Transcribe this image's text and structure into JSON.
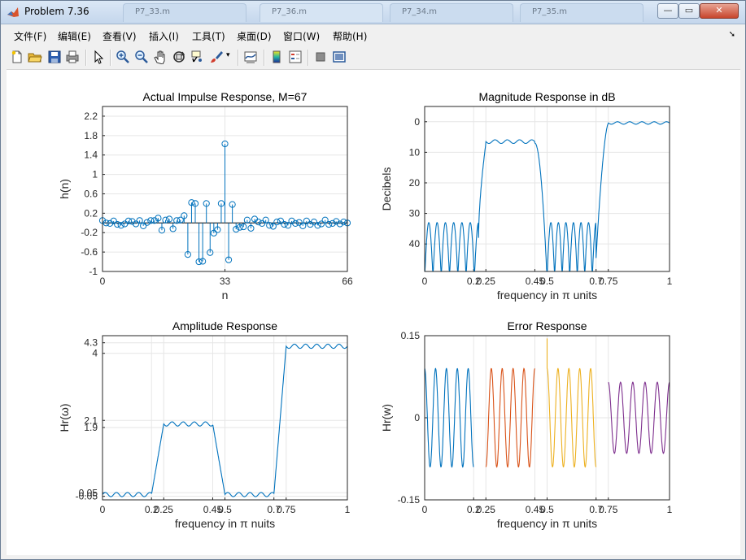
{
  "window": {
    "title": "Problem 7.36",
    "controls": {
      "minimize": "—",
      "restore": "▭",
      "close": "✕"
    }
  },
  "menu": {
    "items": [
      "文件(F)",
      "编辑(E)",
      "查看(V)",
      "插入(I)",
      "工具(T)",
      "桌面(D)",
      "窗口(W)",
      "帮助(H)"
    ]
  },
  "toolbar": {
    "icons": [
      "new-figure-icon",
      "open-file-icon",
      "save-icon",
      "print-icon",
      "pointer-icon",
      "zoom-in-icon",
      "zoom-out-icon",
      "pan-hand-icon",
      "rotate-3d-icon",
      "data-cursor-icon",
      "brush-icon",
      "brush-dropdown-icon",
      "link-plot-icon",
      "colorbar-icon",
      "legend-icon",
      "hide-plot-tools-icon",
      "show-plot-tools-icon"
    ]
  },
  "colors": {
    "series1": "#0072BD",
    "series2": "#D95319",
    "series3": "#EDB120",
    "series4": "#7E2F8E",
    "grid": "#e6e6e6",
    "axis": "#262626"
  },
  "chart_data": [
    {
      "type": "stem",
      "title": "Actual Impulse Response, M=67",
      "xlabel": "n",
      "ylabel": "h(n)",
      "xlim": [
        0,
        66
      ],
      "ylim": [
        -1,
        2.4
      ],
      "xticks": [
        0,
        33,
        66
      ],
      "xtick_labels": [
        "0",
        "33",
        "66"
      ],
      "yticks": [
        -1,
        -0.6,
        -0.2,
        0.2,
        0.6,
        1,
        1.4,
        1.8,
        2.2
      ],
      "ytick_labels": [
        "-1",
        "-0.6",
        "-0.2",
        "0.2",
        "0.6",
        "1",
        "1.4",
        "1.8",
        "2.2"
      ],
      "grid": true,
      "n": [
        0,
        1,
        2,
        3,
        4,
        5,
        6,
        7,
        8,
        9,
        10,
        11,
        12,
        13,
        14,
        15,
        16,
        17,
        18,
        19,
        20,
        21,
        22,
        23,
        24,
        25,
        26,
        27,
        28,
        29,
        30,
        31,
        32,
        33,
        34,
        35,
        36,
        37,
        38,
        39,
        40,
        41,
        42,
        43,
        44,
        45,
        46,
        47,
        48,
        49,
        50,
        51,
        52,
        53,
        54,
        55,
        56,
        57,
        58,
        59,
        60,
        61,
        62,
        63,
        64,
        65,
        66
      ],
      "values": [
        0.05,
        0.0,
        -0.01,
        0.04,
        -0.03,
        -0.05,
        -0.02,
        0.04,
        0.03,
        -0.02,
        0.05,
        -0.06,
        0.01,
        0.05,
        0.05,
        0.1,
        -0.15,
        0.06,
        0.08,
        -0.12,
        0.05,
        0.06,
        0.15,
        -0.65,
        0.42,
        0.4,
        -0.8,
        -0.79,
        0.4,
        -0.61,
        -0.21,
        -0.14,
        0.4,
        1.63,
        -0.76,
        0.38,
        -0.13,
        -0.09,
        -0.08,
        0.06,
        -0.11,
        0.08,
        0.02,
        -0.01,
        0.06,
        -0.05,
        -0.07,
        0.02,
        0.04,
        -0.03,
        -0.05,
        0.04,
        -0.01,
        0.01,
        -0.06,
        0.04,
        -0.03,
        0.02,
        -0.05,
        -0.02,
        0.06,
        -0.03,
        -0.01,
        0.03,
        -0.02,
        0.02,
        0.0
      ]
    },
    {
      "type": "line",
      "title": "Magnitude Response in dB",
      "xlabel": "frequency in π units",
      "ylabel": "Decibels",
      "xlim": [
        0,
        1
      ],
      "ylim": [
        49,
        -5
      ],
      "y_direction": "reversed",
      "xticks": [
        0,
        0.2,
        0.25,
        0.45,
        0.5,
        0.7,
        0.75,
        1
      ],
      "xtick_labels": [
        "0",
        "0.2",
        "0.25",
        "0.45",
        "0.5",
        "0.7",
        "0.75",
        "1"
      ],
      "yticks": [
        0,
        10,
        20,
        30,
        40
      ],
      "ytick_labels": [
        "0",
        "10",
        "20",
        "30",
        "40"
      ],
      "grid": true,
      "bands": [
        {
          "from": 0,
          "to": 0.22,
          "level": "stopband ripple 33–49 dB"
        },
        {
          "from": 0.25,
          "to": 0.45,
          "level": "≈6–7 dB"
        },
        {
          "from": 0.5,
          "to": 0.7,
          "level": "stopband ripple 33–49 dB"
        },
        {
          "from": 0.75,
          "to": 1,
          "level": "≈0 dB"
        }
      ]
    },
    {
      "type": "line",
      "title": "Amplitude Response",
      "xlabel": "frequency in π nuits",
      "ylabel": "Hr(ω)",
      "xlim": [
        0,
        1
      ],
      "ylim": [
        -0.15,
        4.5
      ],
      "xticks": [
        0,
        0.2,
        0.25,
        0.45,
        0.5,
        0.7,
        0.75,
        1
      ],
      "xtick_labels": [
        "0",
        "0.2",
        "0.25",
        "0.45",
        "0.5",
        "0.7",
        "0.75",
        "1"
      ],
      "yticks": [
        -0.05,
        0.05,
        1.9,
        2.1,
        4,
        4.3
      ],
      "ytick_labels": [
        "-0.05",
        "0.05",
        "1.9",
        "2.1",
        "4",
        "4.3"
      ],
      "grid": true,
      "bands": [
        {
          "from": 0,
          "to": 0.2,
          "mean": 0.0,
          "ripple": 0.1
        },
        {
          "from": 0.25,
          "to": 0.45,
          "mean": 2.0,
          "ripple": 0.1
        },
        {
          "from": 0.5,
          "to": 0.7,
          "mean": 0.0,
          "ripple": 0.1
        },
        {
          "from": 0.75,
          "to": 1,
          "mean": 4.2,
          "ripple": 0.1
        }
      ]
    },
    {
      "type": "line",
      "title": "Error Response",
      "xlabel": "frequency in π units",
      "ylabel": "Hr(w)",
      "xlim": [
        0,
        1
      ],
      "ylim": [
        -0.15,
        0.15
      ],
      "xticks": [
        0,
        0.2,
        0.25,
        0.45,
        0.5,
        0.7,
        0.75,
        1
      ],
      "xtick_labels": [
        "0",
        "0.2",
        "0.25",
        "0.45",
        "0.5",
        "0.7",
        "0.75",
        "1"
      ],
      "yticks": [
        -0.15,
        0,
        0.15
      ],
      "ytick_labels": [
        "-0.15",
        "0",
        "0.15"
      ],
      "grid": true,
      "series": [
        {
          "from": 0,
          "to": 0.2,
          "amplitude": 0.09,
          "cycles": 4.5
        },
        {
          "from": 0.25,
          "to": 0.45,
          "amplitude": 0.09,
          "cycles": 4.5
        },
        {
          "from": 0.5,
          "to": 0.7,
          "amplitude": 0.09,
          "cycles": 4.5
        },
        {
          "from": 0.75,
          "to": 1,
          "amplitude": 0.065,
          "cycles": 5
        }
      ]
    }
  ]
}
